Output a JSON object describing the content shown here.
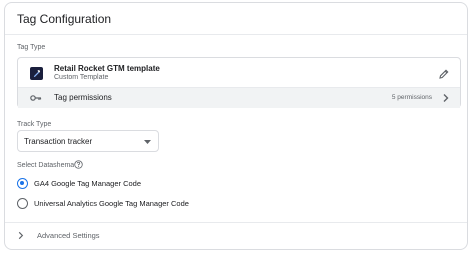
{
  "panel": {
    "title": "Tag Configuration"
  },
  "tag_type": {
    "label": "Tag Type",
    "template_name": "Retail Rocket GTM template",
    "template_type": "Custom Template",
    "template_icon": "tag-template-icon",
    "edit_icon": "pencil-icon",
    "permissions": {
      "label": "Tag permissions",
      "count": "5 permissions",
      "icon": "key-icon"
    }
  },
  "track_type": {
    "label": "Track Type",
    "selected": "Transaction tracker"
  },
  "datashema": {
    "label": "Select Datashema",
    "help_icon": "help-icon",
    "options": [
      {
        "label": "GA4 Google Tag Manager Code",
        "checked": true
      },
      {
        "label": "Universal Analytics Google Tag Manager Code",
        "checked": false
      }
    ]
  },
  "advanced": {
    "label": "Advanced Settings"
  },
  "colors": {
    "accent": "#1a73e8",
    "border": "#dadce0",
    "muted": "#5f6368",
    "template_icon_bg": "#1a1f3d"
  }
}
